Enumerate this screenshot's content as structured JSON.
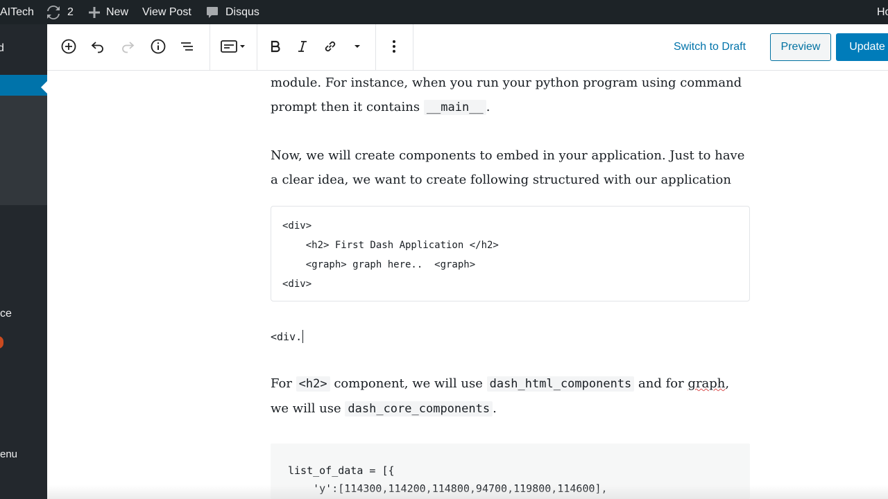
{
  "adminbar": {
    "site_name": "AITech",
    "updates_count": "2",
    "new_label": "New",
    "view_post_label": "View Post",
    "disqus_label": "Disqus",
    "right_clipped": "Ho"
  },
  "sidebar": {
    "top_clipped": "d",
    "item_ce": "ce",
    "item_menu": "enu"
  },
  "toolbar": {
    "switch_to_draft": "Switch to Draft",
    "preview": "Preview",
    "update": "Update"
  },
  "content": {
    "p1_line1": "module. For instance, when you run your python program using command",
    "p1_line2_pre": "prompt then it contains ",
    "p1_code": "__main__",
    "p1_line2_post": ".",
    "p2_line1": "Now, we will create components to embed in your application. Just to have",
    "p2_line2": "a clear idea, we want to create following structured with our application",
    "code_block": "<div>\n    <h2> First Dash Application </h2>\n    <graph> graph here..  <graph>\n<div>",
    "typing_text": "<div.",
    "p3_for": "For ",
    "p3_code1": "<h2>",
    "p3_mid": " component, we will use ",
    "p3_code2": "dash_html_components",
    "p3_and": " and for ",
    "p3_graph": "graph",
    "p3_comma": ",",
    "p3_line2_pre": "we will use ",
    "p3_code3": "dash_core_components",
    "p3_line2_post": ".",
    "code_block2": "list_of_data = [{\n    'y':[114300,114200,114800,94700,119800,114600],"
  },
  "colors": {
    "adminbar_bg": "#1d2327",
    "sidebar_bg": "#23282d",
    "accent_blue": "#0073aa",
    "update_bg": "#007cba"
  }
}
